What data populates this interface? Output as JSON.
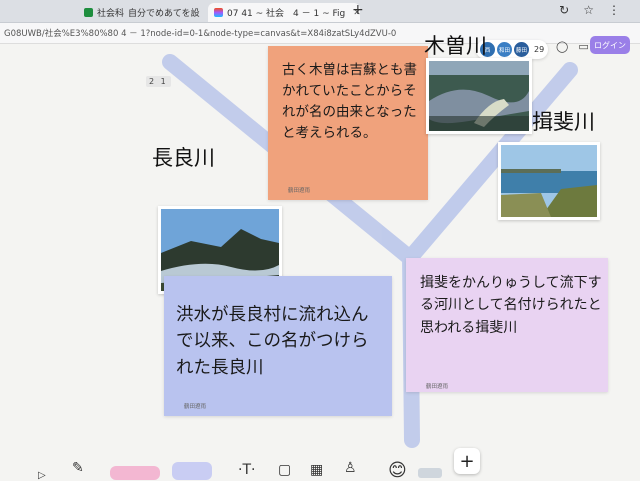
{
  "browser": {
    "tabs": [
      {
        "label": "社会科",
        "icon": "sheets-icon"
      },
      {
        "label": "自分でめあてを設",
        "icon": "docs-icon"
      },
      {
        "label": "07 41 ~ 社会　4 － 1 ~ Fig",
        "icon": "figma-icon"
      }
    ],
    "new_tab": "+",
    "url": "G08UWB/社会%E3%80%80 4 － 1?node-id=0-1&node-type=canvas&t=X84i8zatSLy4dZVU-0"
  },
  "figma": {
    "avatars": [
      "西",
      "和田",
      "藤田"
    ],
    "avatar_count": "29",
    "share_label": "ログイン",
    "page_badge": "2 1"
  },
  "canvas": {
    "labels": {
      "nagara": "長良川",
      "kiso": "木曽川",
      "ibi": "揖斐川"
    },
    "notes": {
      "kiso": {
        "text": "古く木曽は吉蘇とも書かれていたことからそれが名の由来となったと考えられる。",
        "author": "鶴田遼雨",
        "color": "#f0a27c"
      },
      "nagara": {
        "text": "洪水が長良村に流れ込んで以来、この名がつけられた長良川",
        "author": "鶴田遼雨",
        "color": "#b9c3ef"
      },
      "ibi": {
        "text": "揖斐をかんりゅうして流下する河川として名付けられたと思われる揖斐川",
        "author": "鶴田遼雨",
        "color": "#e9d3f2"
      }
    },
    "photos": {
      "nagara": "mountain-river-photo",
      "kiso": "aerial-river-photo",
      "ibi": "wide-river-photo"
    },
    "colors": {
      "river": "#b8c4ea",
      "accent": "#9a7fe8"
    }
  },
  "toolbar": {
    "text_tool": "·T·",
    "add": "+"
  }
}
